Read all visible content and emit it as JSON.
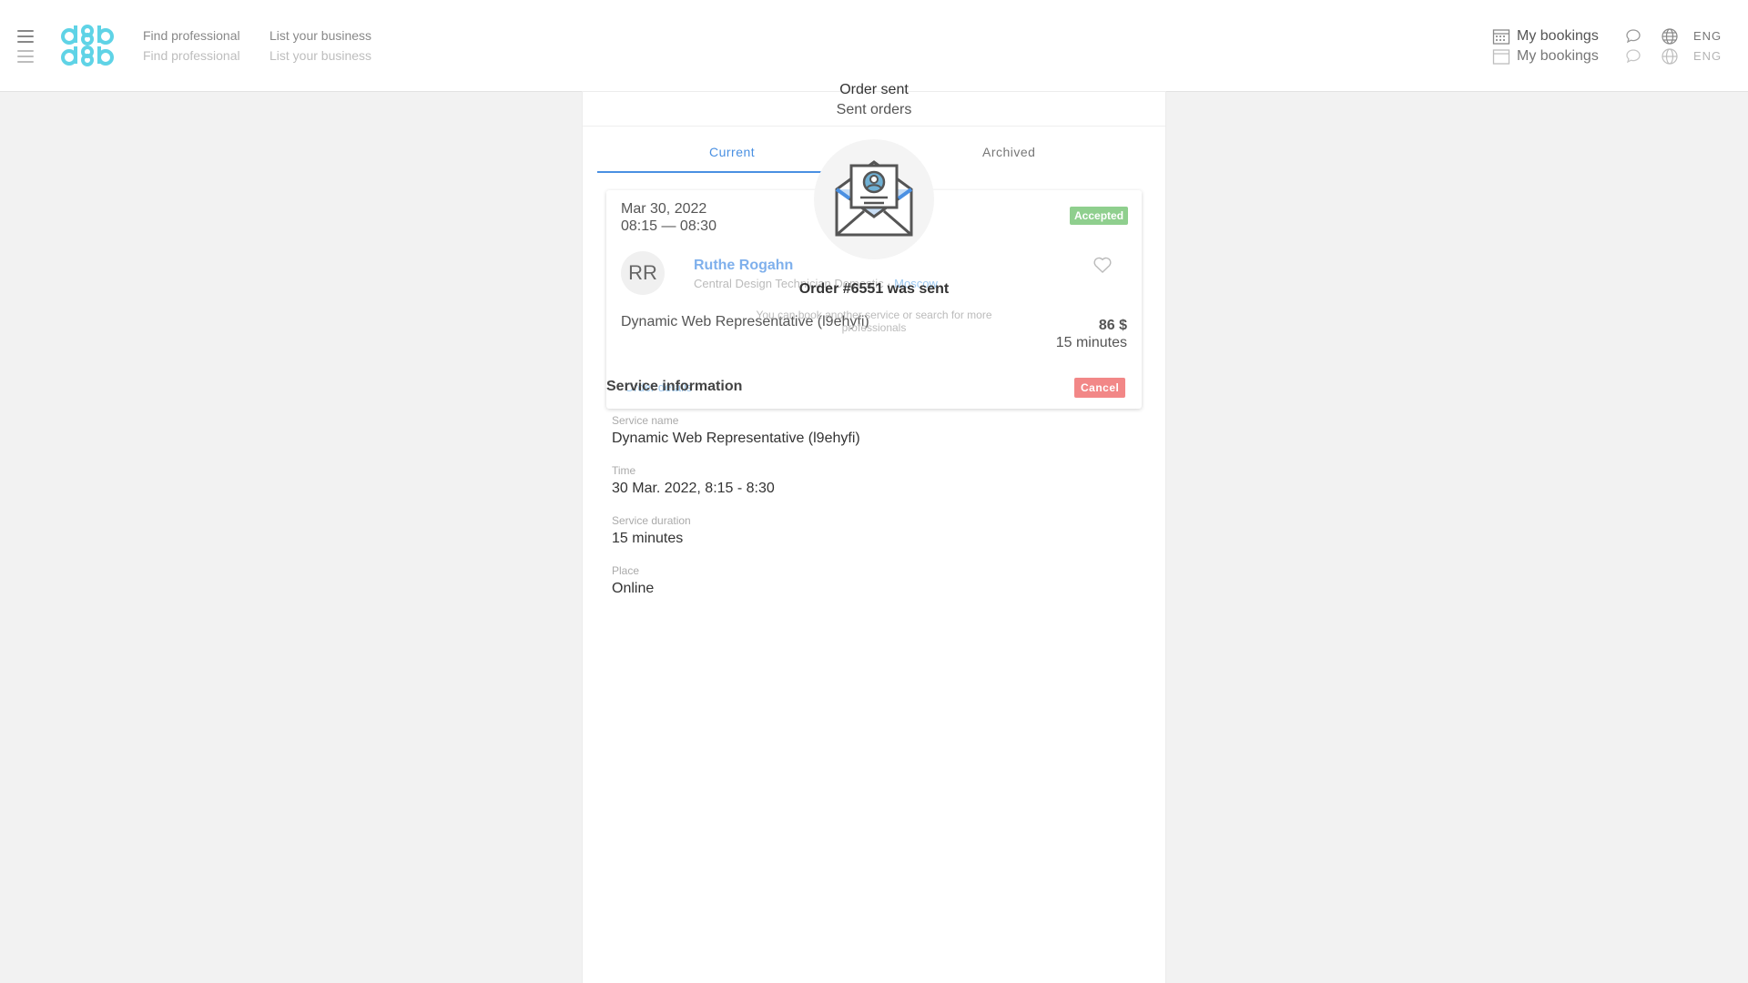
{
  "header": {
    "logo_text": "d8b d8b",
    "nav": {
      "find_professional": "Find professional",
      "list_business": "List your business"
    },
    "my_bookings": "My bookings",
    "language": "ENG"
  },
  "page": {
    "title": "Order sent",
    "subtitle": "Sent orders"
  },
  "tabs": {
    "current": "Current",
    "archived": "Archived"
  },
  "booking": {
    "date": "Mar 30, 2022",
    "time": "08:15 — 08:30",
    "status": "Accepted",
    "initials": "RR",
    "pro_name": "Ruthe Rogahn",
    "pro_title": "Central Design Technician",
    "pro_separator": "Domestic · ",
    "pro_city": "Moscow",
    "service": "Dynamic Web Representative (l9ehyfi)",
    "price": "86 $",
    "duration": "15 minutes",
    "details_link": "Order details",
    "cancel": "Cancel"
  },
  "modal": {
    "heading": "Order #6551 was sent",
    "desc_line1": "You can book another service or search for more",
    "desc_line2": "professionals"
  },
  "service_info": {
    "heading": "Service information",
    "fields": [
      {
        "label": "Service name",
        "value": "Dynamic Web Representative (l9ehyfi)"
      },
      {
        "label": "Time",
        "value": "30 Mar. 2022, 8:15 - 8:30"
      },
      {
        "label": "Service duration",
        "value": "15 minutes"
      },
      {
        "label": "Place",
        "value": "Online"
      }
    ]
  },
  "colors": {
    "accent": "#4a90e2",
    "accepted": "#6abf69",
    "cancel": "#ef6a6a",
    "logo": "#5fd3e6"
  }
}
